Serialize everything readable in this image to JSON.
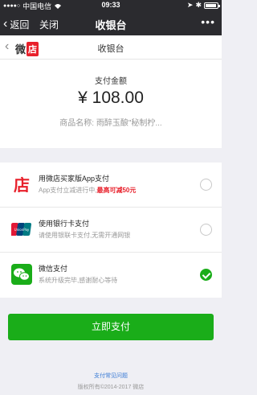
{
  "status_bar": {
    "signal": "●●●●○",
    "carrier": "中国电信",
    "time": "09:33"
  },
  "nav_bar": {
    "back_label": "返回",
    "close_label": "关闭",
    "title": "收银台",
    "more_label": "•••"
  },
  "page_header": {
    "logo_text": "微",
    "logo_box": "店",
    "title": "收银台"
  },
  "amount": {
    "label": "支付金额",
    "value": "¥ 108.00",
    "product": "商品名称:  雨醉玉酿\"秘制柠..."
  },
  "methods": [
    {
      "icon": "weidian-icon",
      "name": "用微店买家版App支付",
      "desc_prefix": "App支付立减进行中,",
      "desc_highlight": "最高可减50元",
      "selected": false
    },
    {
      "icon": "unionpay-icon",
      "name": "使用银行卡支付",
      "desc": "请使用银联卡支付,无需开通网银",
      "selected": false
    },
    {
      "icon": "wechat-pay-icon",
      "name": "微信支付",
      "desc": "系统升级完毕,感谢耐心等待",
      "selected": true
    }
  ],
  "pay_button": "立即支付",
  "footer": {
    "faq_link": "支付常见问题",
    "copyright": "版权所有©2014-2017 微店"
  },
  "colors": {
    "accent_green": "#1aad19",
    "weidian_red": "#e8202b",
    "nav_dark": "#2b2b2f"
  }
}
